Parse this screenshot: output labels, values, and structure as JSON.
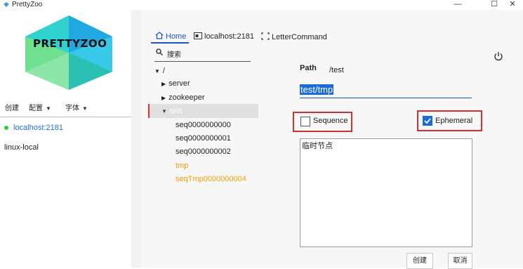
{
  "window": {
    "title": "PrettyZoo",
    "minimize": "—",
    "maximize": "☐",
    "close": "✕"
  },
  "sidebar": {
    "logo_text": "PRETTYZOO",
    "menu": {
      "create": "创建",
      "config": "配置",
      "font": "字体"
    },
    "servers": [
      {
        "label": "localhost:2181",
        "connected": true,
        "status_color": "#2ecc40"
      },
      {
        "label": "linux-local",
        "connected": false
      }
    ]
  },
  "tabs": [
    {
      "label": "Home",
      "active": true
    },
    {
      "label": "localhost:2181"
    },
    {
      "label": "LetterCommand"
    }
  ],
  "search": {
    "placeholder": "搜索"
  },
  "tree": {
    "root": "/",
    "items": [
      {
        "label": "server",
        "expandable": true
      },
      {
        "label": "zookeeper",
        "expandable": true
      },
      {
        "label": "test",
        "expanded": true,
        "selected": true
      },
      {
        "label": "seq0000000000"
      },
      {
        "label": "seq0000000001"
      },
      {
        "label": "seq0000000002"
      },
      {
        "label": "tmp",
        "ephemeral": true
      },
      {
        "label": "seqTmp0000000004",
        "ephemeral": true
      }
    ]
  },
  "form": {
    "path_label": "Path",
    "path_value": "/test",
    "node_name": "test/tmp",
    "sequence_label": "Sequence",
    "sequence_checked": false,
    "ephemeral_label": "Ephemeral",
    "ephemeral_checked": true,
    "data_value": "临时节点",
    "create_button": "创建",
    "cancel_button": "取消"
  },
  "colors": {
    "accent": "#1a56c4",
    "ephemeral_node": "#f0a000",
    "highlight_box": "#d23030"
  }
}
